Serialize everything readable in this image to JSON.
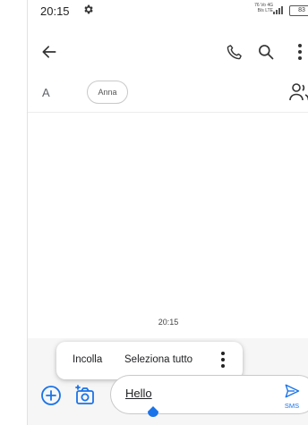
{
  "status_bar": {
    "time": "20:15",
    "network_top": "76 Vo 4G",
    "network_bottom": "B/s LTE",
    "battery": "83"
  },
  "app_bar": {
    "back_icon": "arrow-left-icon",
    "call_icon": "phone-icon",
    "search_icon": "search-icon",
    "more_icon": "more-vert-icon"
  },
  "recipients": {
    "avatar_letter": "A",
    "chip_label": "Anna",
    "group_icon": "group-add-icon"
  },
  "messages": {
    "timestamp": "20:15"
  },
  "text_menu": {
    "paste": "Incolla",
    "select_all": "Seleziona tutto"
  },
  "compose": {
    "text": "Hello",
    "send_label": "SMS"
  },
  "colors": {
    "accent": "#1a73e8",
    "background": "#ffffff",
    "compose_area": "#f6f6f6"
  }
}
